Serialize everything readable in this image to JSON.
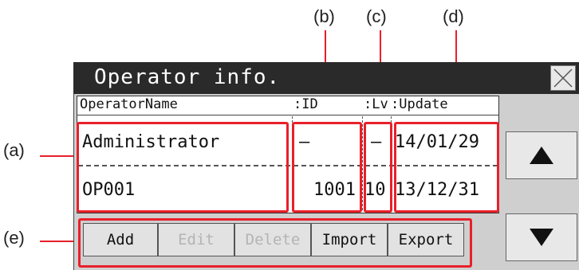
{
  "callouts": {
    "a": "(a)",
    "b": "(b)",
    "c": "(c)",
    "d": "(d)",
    "e": "(e)"
  },
  "window": {
    "title": "Operator info."
  },
  "table": {
    "headers": {
      "name": "OperatorName",
      "id": ":ID",
      "lv": ":Lv",
      "update": ":Update"
    },
    "rows": [
      {
        "name": "Administrator",
        "id": "—",
        "lv": "—",
        "update": "14/01/29"
      },
      {
        "name": "OP001",
        "id": "1001",
        "lv": "10",
        "update": "13/12/31"
      }
    ]
  },
  "buttons": {
    "add": "Add",
    "edit": "Edit",
    "delete": "Delete",
    "import": "Import",
    "export": "Export"
  },
  "icons": {
    "close": "close-icon",
    "up": "arrow-up-icon",
    "down": "arrow-down-icon"
  },
  "colors": {
    "highlight": "#e8202a",
    "titlebar": "#2a2a2a"
  }
}
